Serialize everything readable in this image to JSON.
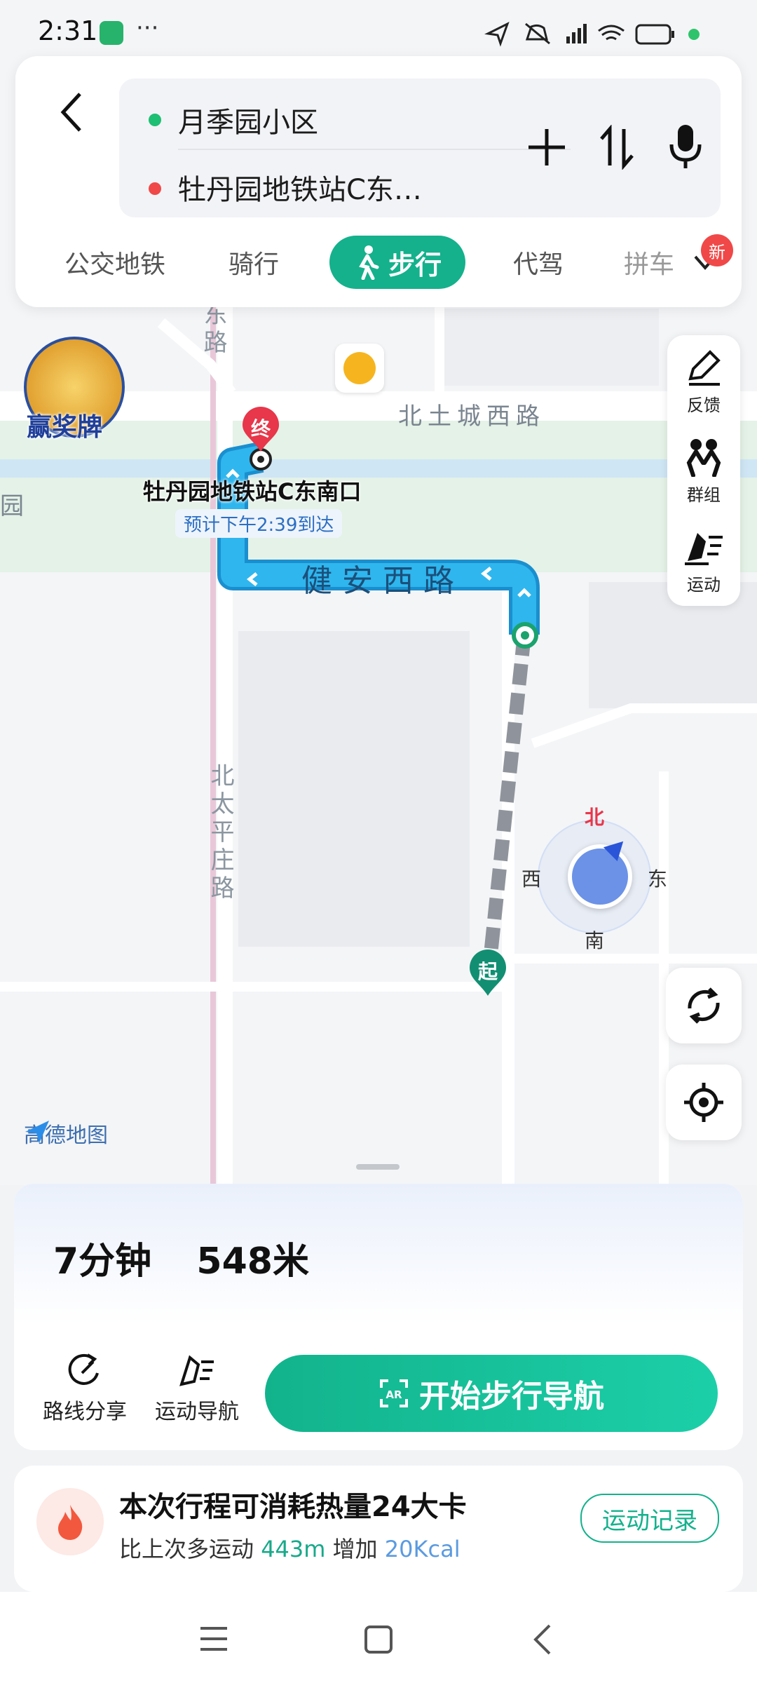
{
  "status_bar": {
    "time": "2:31"
  },
  "route": {
    "origin": "月季园小区",
    "destination": "牡丹园地铁站C东…",
    "origin_color": "#1dbf73",
    "destination_color": "#f04848"
  },
  "mode_tabs": [
    {
      "label": "公交地铁"
    },
    {
      "label": "骑行"
    },
    {
      "label": "步行",
      "active": true
    },
    {
      "label": "代驾"
    },
    {
      "label": "拼车"
    }
  ],
  "new_badge": "新",
  "promo": {
    "label": "赢奖牌"
  },
  "map": {
    "road_labels": {
      "top_road": "北土城西路",
      "main_route": "健安西路",
      "vertical_road": "北太平庄路",
      "partial_top": "东路",
      "left_edge": "园"
    },
    "end_marker": "终",
    "start_marker": "起",
    "destination_label": "牡丹园地铁站C东南口",
    "eta_label": "预计下午2:39到达",
    "compass": {
      "north": "北",
      "south": "南",
      "east": "东",
      "west": "西"
    },
    "logo_text": "高德地图"
  },
  "tools": [
    {
      "label": "反馈",
      "icon": "edit-icon"
    },
    {
      "label": "群组",
      "icon": "group-icon"
    },
    {
      "label": "运动",
      "icon": "run-icon"
    }
  ],
  "summary": {
    "duration": "7分钟",
    "distance": "548米",
    "share_label": "路线分享",
    "sport_nav_label": "运动导航",
    "start_button": "开始步行导航"
  },
  "calorie": {
    "title": "本次行程可消耗热量24大卡",
    "sub_prefix": "比上次多运动",
    "sub_distance": "443m",
    "sub_mid": "增加",
    "sub_kcal": "20Kcal",
    "record_button": "运动记录"
  },
  "colors": {
    "accent": "#14b18c",
    "route_blue": "#2aa8e8",
    "end_red": "#e8364a"
  }
}
